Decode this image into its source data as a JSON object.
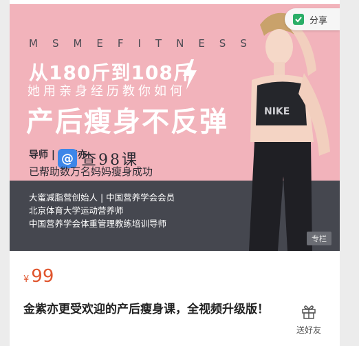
{
  "share": {
    "label": "分享"
  },
  "banner": {
    "brand": "MSMEFITNESS",
    "headline": "从180斤到108斤",
    "subheadline": "她用亲身经历教你如何",
    "tagline": "产后瘦身不反弹",
    "mentor": "导师 | 金紫亦",
    "mentor_desc": "已帮助数万名妈妈瘦身成功",
    "watermark_text": "查98课",
    "credentials": [
      "大蜜减脂营创始人  |  中国营养学会会员",
      "北京体育大学运动营养师",
      "中国营养学会体重管理教练培训导师"
    ],
    "tag": "专栏",
    "colors": {
      "pink": "#f2b3bb",
      "dark": "#45474f"
    }
  },
  "product": {
    "currency": "¥",
    "price": "99",
    "title": "金紫亦更受欢迎的产后瘦身课，全视频升级版！",
    "gift_label": "送好友",
    "price_color": "#e0542c"
  }
}
